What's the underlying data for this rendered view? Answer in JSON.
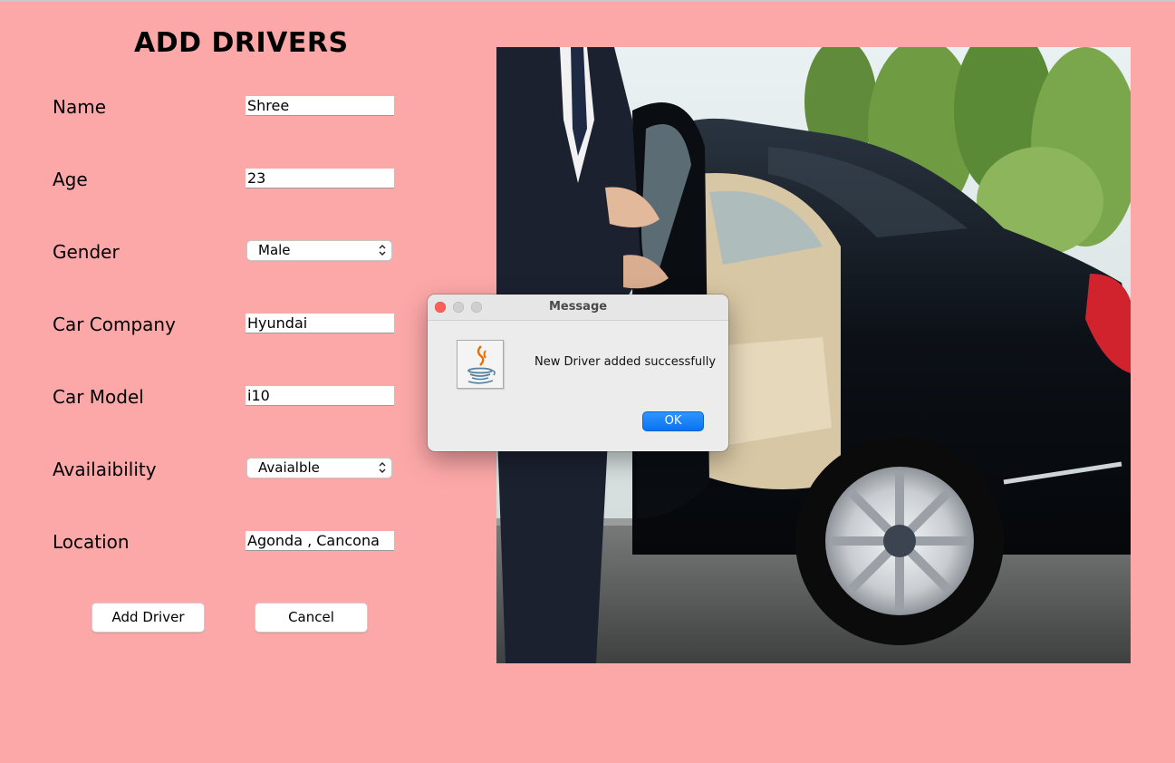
{
  "form": {
    "title": "ADD DRIVERS",
    "fields": [
      {
        "label": "Name",
        "value": "Shree"
      },
      {
        "label": "Age",
        "value": "23"
      },
      {
        "label": "Gender",
        "value": "Male"
      },
      {
        "label": "Car Company",
        "value": "Hyundai"
      },
      {
        "label": "Car Model",
        "value": "i10"
      },
      {
        "label": "Availaibility",
        "value": "Avaialble"
      },
      {
        "label": "Location",
        "value": "Agonda , Cancona"
      }
    ],
    "add_label": "Add Driver",
    "cancel_label": "Cancel"
  },
  "dialog": {
    "title": "Message",
    "message": "New Driver added successfully",
    "ok_label": "OK",
    "icon": "java-coffee-cup-icon"
  },
  "colors": {
    "background": "#fda8a8",
    "ok_button": "#0a72f0",
    "close_dot": "#fe5f57"
  }
}
